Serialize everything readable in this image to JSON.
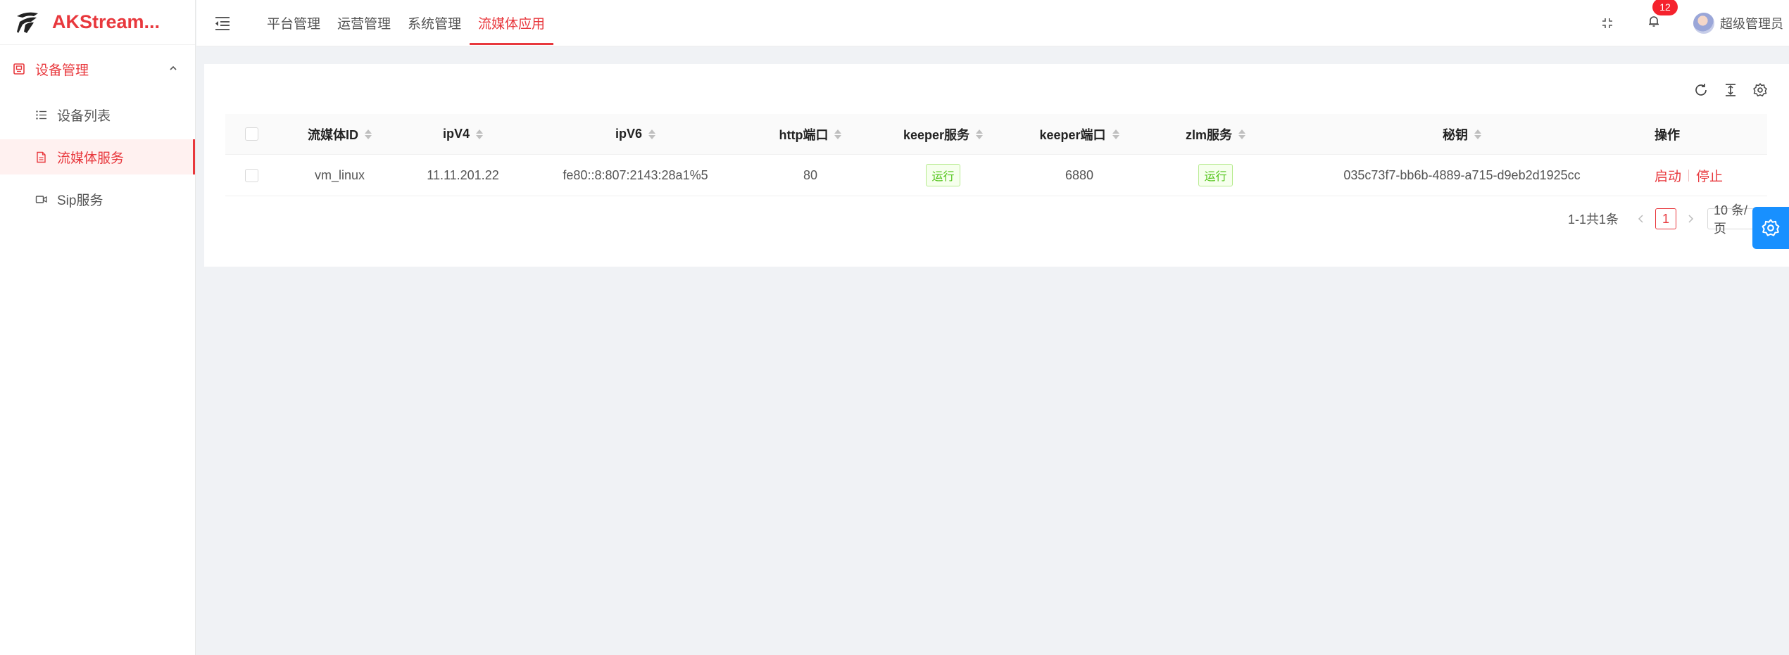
{
  "app": {
    "title": "AKStream..."
  },
  "sidebar": {
    "group": {
      "label": "设备管理"
    },
    "items": [
      {
        "label": "设备列表",
        "icon": "list-icon"
      },
      {
        "label": "流媒体服务",
        "icon": "file-icon",
        "active": true
      },
      {
        "label": "Sip服务",
        "icon": "video-icon"
      }
    ]
  },
  "header": {
    "nav": [
      "平台管理",
      "运营管理",
      "系统管理",
      "流媒体应用"
    ],
    "active_nav": "流媒体应用",
    "notification_count": "12",
    "user_name": "超级管理员"
  },
  "table": {
    "columns": [
      "流媒体ID",
      "ipV4",
      "ipV6",
      "http端口",
      "keeper服务",
      "keeper端口",
      "zlm服务",
      "秘钥",
      "操作"
    ],
    "rows": [
      {
        "id": "vm_linux",
        "ipv4": "11.11.201.22",
        "ipv6": "fe80::8:807:2143:28a1%5",
        "http_port": "80",
        "keeper_service": "运行",
        "keeper_port": "6880",
        "zlm_service": "运行",
        "secret": "035c73f7-bb6b-4889-a715-d9eb2d1925cc",
        "actions": [
          "启动",
          "停止"
        ]
      }
    ]
  },
  "pagination": {
    "total": "1-1共1条",
    "current": "1",
    "page_size": "10 条/页"
  },
  "colors": {
    "accent": "#e8383d",
    "success": "#52c41a",
    "float_button": "#1890ff"
  }
}
